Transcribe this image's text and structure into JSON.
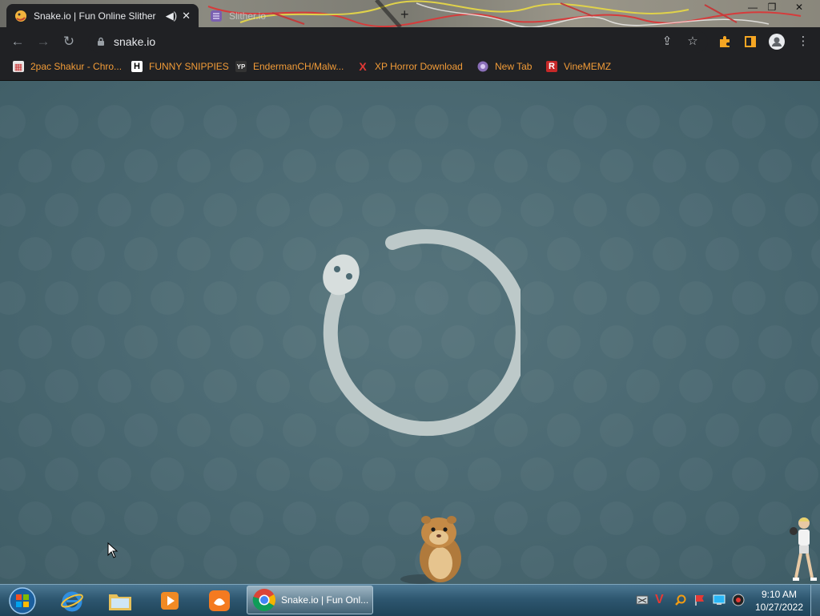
{
  "browser": {
    "tabs": [
      {
        "title": "Snake.io | Fun Online Slither",
        "active": true,
        "audio_icon": "speaker-icon",
        "close": "✕"
      },
      {
        "title": "Slither.io",
        "active": false
      }
    ],
    "new_tab": "+",
    "window_controls": {
      "minimize": "—",
      "maximize": "❐",
      "close": "✕"
    },
    "toolbar": {
      "url": "snake.io"
    },
    "bookmarks": [
      {
        "label": "2pac Shakur - Chro...",
        "icon": "bookmark-icon-calendar"
      },
      {
        "label": "FUNNY SNIPPIES",
        "icon": "bookmark-icon-h"
      },
      {
        "label": "EndermanCH/Malw...",
        "icon": "bookmark-icon-yp"
      },
      {
        "label": "XP Horror Download",
        "icon": "bookmark-icon-x"
      },
      {
        "label": "New Tab",
        "icon": "bookmark-icon-globe"
      },
      {
        "label": "VineMEMZ",
        "icon": "bookmark-icon-r"
      }
    ]
  },
  "taskbar": {
    "chrome_task_label": "Snake.io | Fun Onl...",
    "clock_time": "9:10 AM",
    "clock_date": "10/27/2022"
  },
  "colors": {
    "page_bg": "#4c6a73",
    "loader_ring": "#c9d3d2",
    "bookmark_text": "#f29c38",
    "chrome_dark": "#202124"
  }
}
